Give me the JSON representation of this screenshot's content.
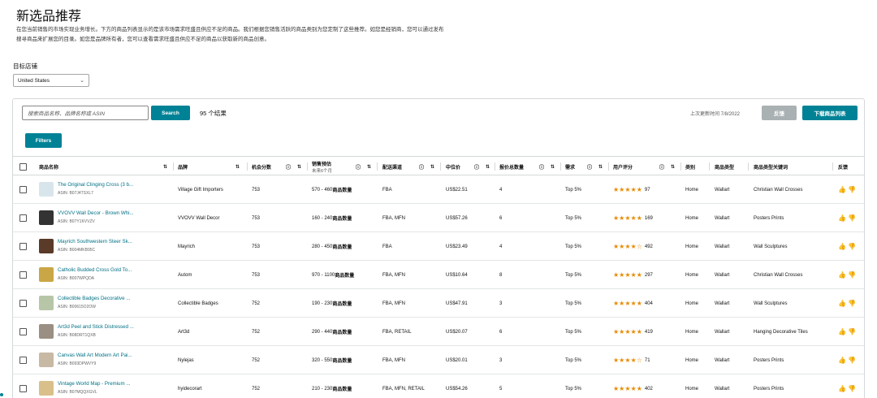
{
  "page": {
    "title": "新选品推荐",
    "description_line1": "在您当前销售的市场实现业务增长。下方的商品列表显示的是该市场需求旺盛且供应不足的商品。我们根据您销售活跃的商品类别为您定制了这些推荐。如您是经销商，您可以通过发布",
    "description_line2": "搜寻商品来扩展您的目录。如您是品牌所有者，您可以查看需求旺盛且供应不足的商品以获取新的商品创意。"
  },
  "target_store": {
    "label": "目标店铺",
    "selected": "United States"
  },
  "toolbar": {
    "search_placeholder": "搜索商品名称、品牌名称或 ASIN",
    "search_button": "Search",
    "result_count": "95 个结果",
    "last_updated": "上次更新时间 7/8/2022",
    "feedback_button": "反馈",
    "download_button": "下载商品列表",
    "filters_button": "Filters"
  },
  "columns": {
    "name": "商品名称",
    "brand": "品牌",
    "opportunity": "机会分数",
    "sales_range": "销售预估",
    "sales_range_sub": "未来6个月",
    "fulfillment": "配送渠道",
    "median_price": "中位价",
    "offers": "报价总数量",
    "demand": "需求",
    "rating": "用户评分",
    "category": "类别",
    "product_type": "商品类型",
    "keywords": "商品类型关键词",
    "feedback": "反馈"
  },
  "rows": [
    {
      "name": "The Original Clinging Cross (3 b...",
      "asin": "ASIN: B07J4TSXL7",
      "brand": "Village Gift Importers",
      "score": "753",
      "sales": "570 - 460 ",
      "sales_unit": "商品数量",
      "fulfillment": "FBA",
      "price": "US$22.51",
      "offers": "4",
      "demand": "Top 5%",
      "stars": "★★★★★",
      "rating_count": "97",
      "category": "Home",
      "product_type": "Wallart",
      "keyword": "Christian Wall Crosses"
    },
    {
      "name": "VVOVV Wall Decor - Brown Whi...",
      "asin": "ASIN: B07Y1KVVZV",
      "brand": "VVOVV Wall Decor",
      "score": "753",
      "sales": "160 - 240 ",
      "sales_unit": "商品数量",
      "fulfillment": "FBA, MFN",
      "price": "US$57.26",
      "offers": "6",
      "demand": "Top 5%",
      "stars": "★★★★★",
      "rating_count": "169",
      "category": "Home",
      "product_type": "Wallart",
      "keyword": "Posters Prints"
    },
    {
      "name": "Mayrich Southwestern Steer Sk...",
      "asin": "ASIN: B004MKB95C",
      "brand": "Mayrich",
      "score": "753",
      "sales": "280 - 450 ",
      "sales_unit": "商品数量",
      "fulfillment": "FBA",
      "price": "US$23.49",
      "offers": "4",
      "demand": "Top 5%",
      "stars": "★★★★☆",
      "rating_count": "492",
      "category": "Home",
      "product_type": "Wallart",
      "keyword": "Wall Sculptures"
    },
    {
      "name": "Catholic Budded Cross Gold To...",
      "asin": "ASIN: B007WPQDA",
      "brand": "Autom",
      "score": "753",
      "sales": "970 - 1100 ",
      "sales_unit": "商品数量",
      "fulfillment": "FBA, MFN",
      "price": "US$10.64",
      "offers": "8",
      "demand": "Top 5%",
      "stars": "★★★★★",
      "rating_count": "297",
      "category": "Home",
      "product_type": "Wallart",
      "keyword": "Christian Wall Crosses"
    },
    {
      "name": "Collectible Badges Decorative ...",
      "asin": "ASIN: B00615O2OW",
      "brand": "Collectible Badges",
      "score": "752",
      "sales": "190 - 230 ",
      "sales_unit": "商品数量",
      "fulfillment": "FBA, MFN",
      "price": "US$47.91",
      "offers": "3",
      "demand": "Top 5%",
      "stars": "★★★★★",
      "rating_count": "404",
      "category": "Home",
      "product_type": "Wallart",
      "keyword": "Wall Sculptures"
    },
    {
      "name": "Art3d Peel and Stick Distressed ...",
      "asin": "ASIN: B08DRT1QXB",
      "brand": "Art3d",
      "score": "752",
      "sales": "290 - 440 ",
      "sales_unit": "商品数量",
      "fulfillment": "FBA, RETAIL",
      "price": "US$20.07",
      "offers": "6",
      "demand": "Top 5%",
      "stars": "★★★★★",
      "rating_count": "419",
      "category": "Home",
      "product_type": "Wallart",
      "keyword": "Hanging Decorative Tiles"
    },
    {
      "name": "Canvas Wall Art Modern Art Pai...",
      "asin": "ASIN: B093DPWVY9",
      "brand": "Nylejas",
      "score": "752",
      "sales": "320 - 550 ",
      "sales_unit": "商品数量",
      "fulfillment": "FBA, MFN",
      "price": "US$20.01",
      "offers": "3",
      "demand": "Top 5%",
      "stars": "★★★★☆",
      "rating_count": "71",
      "category": "Home",
      "product_type": "Wallart",
      "keyword": "Posters Prints"
    },
    {
      "name": "Vintage World Map - Premium ...",
      "asin": "ASIN: B07MQQXGVL",
      "brand": "hyidecorart",
      "score": "752",
      "sales": "210 - 230 ",
      "sales_unit": "商品数量",
      "fulfillment": "FBA, MFN, RETAIL",
      "price": "US$54.26",
      "offers": "5",
      "demand": "Top 5%",
      "stars": "★★★★★",
      "rating_count": "402",
      "category": "Home",
      "product_type": "Wallart",
      "keyword": "Posters Prints"
    }
  ],
  "thumb_colors": [
    "#d8e6ec",
    "#333333",
    "#5a3a28",
    "#c9a646",
    "#b8c6a8",
    "#9a8f82",
    "#c8b9a4",
    "#d9c08a"
  ],
  "accent_color": "#008296"
}
